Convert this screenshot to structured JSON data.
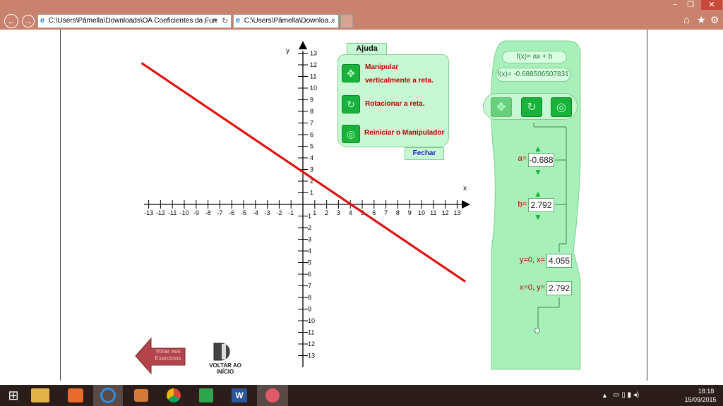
{
  "browser": {
    "address_text": "C:\\Users\\Pâmella\\Downloads\\OA Coeficientes da Fun",
    "tab_label": "C:\\Users\\Pâmella\\Downloa...",
    "tab_close": "×",
    "search_glyph": "⌕",
    "dropdown_glyph": "▾",
    "refresh_glyph": "↻",
    "ie_glyph": "e",
    "back_glyph": "←",
    "forward_glyph": "→",
    "home_glyph": "⌂",
    "star_glyph": "★",
    "gear_glyph": "⚙",
    "min_glyph": "−",
    "max_glyph": "❐",
    "close_glyph": "✕"
  },
  "graph": {
    "x_label": "x",
    "y_label": "y",
    "x_ticks_neg": [
      "-13",
      "-12",
      "-11",
      "-10",
      "-9",
      "-8",
      "-7",
      "-6",
      "-5",
      "-4",
      "-3",
      "-2",
      "-1"
    ],
    "x_ticks_pos": [
      "1",
      "2",
      "3",
      "4",
      "5",
      "6",
      "7",
      "8",
      "9",
      "10",
      "11",
      "12",
      "13"
    ],
    "y_ticks_pos": [
      "13",
      "12",
      "11",
      "10",
      "9",
      "8",
      "7",
      "6",
      "5",
      "4",
      "3",
      "2",
      "1"
    ],
    "y_ticks_neg": [
      "-1",
      "-2",
      "-3",
      "-4",
      "-5",
      "-6",
      "-7",
      "-8",
      "-9",
      "-10",
      "-11",
      "-12",
      "-13"
    ],
    "line_color": "#e01010",
    "slope": -0.6885065,
    "intercept": 2.792
  },
  "help": {
    "tab_label": "Ajuda",
    "item1_line1": "Manipular",
    "item1_line2": "verticalmente a reta.",
    "item2": "Rotacionar a reta.",
    "item3": "Reiniciar o Manipulador",
    "close_label": "Fechar",
    "move_icon": "✥",
    "rotate_icon": "↻",
    "reset_icon": "◎"
  },
  "panel": {
    "formula_generic": "f(x)= ax + b",
    "formula_value": "f(x)= -0.688506507831",
    "a_label": "a=",
    "a_value": "-0.688",
    "b_label": "b=",
    "b_value": "2.792",
    "root_label": "y=0, x=",
    "root_value": "4.055",
    "yint_label": "x=0, y=",
    "yint_value": "2.792",
    "arrow_up": "▲",
    "arrow_down": "▼"
  },
  "nav": {
    "back_label_line1": "Voltar aos",
    "back_label_line2": "Exercícios",
    "home_label_line1": "VOLTAR AO",
    "home_label_line2": "INÍCIO"
  },
  "taskbar": {
    "start_glyph": "⊞",
    "time": "18:18",
    "date": "15/09/2015",
    "tray_up": "▲",
    "tray_icons": "▭ ▯ ▮ ◂)"
  }
}
